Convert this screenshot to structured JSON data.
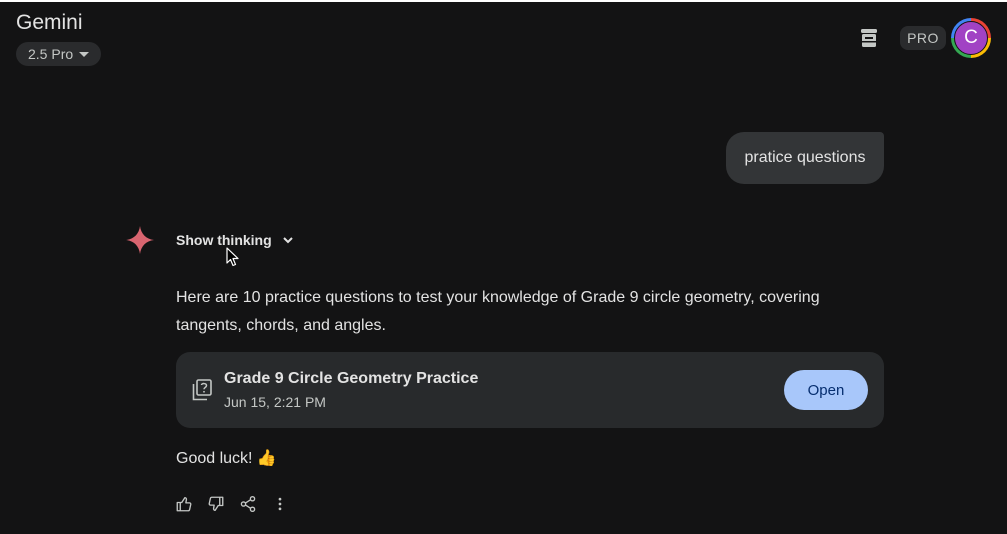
{
  "app": {
    "title": "Gemini"
  },
  "model": {
    "label": "2.5 Pro"
  },
  "header": {
    "pro_badge": "PRO",
    "avatar_initial": "C"
  },
  "chat": {
    "user_message": "pratice questions",
    "thinking_toggle": "Show thinking",
    "response_text": "Here are 10 practice questions to test your knowledge of Grade 9 circle geometry, covering tangents, chords, and angles.",
    "document": {
      "title": "Grade 9 Circle Geometry Practice",
      "date": "Jun 15, 2:21 PM",
      "open_label": "Open"
    },
    "closing_text": "Good luck! 👍"
  },
  "icons": {
    "header_action": "archive-icon",
    "thinking_expand": "chevron-down-icon",
    "assistant": "gemini-spark-icon",
    "document": "quiz-doc-icon",
    "actions": [
      "thumbs-up-icon",
      "thumbs-down-icon",
      "share-icon",
      "more-vertical-icon"
    ]
  },
  "colors": {
    "background": "#131314",
    "bubble": "#333537",
    "card": "#282a2c",
    "accent_button": "#a8c7fa",
    "spark": "#d96570",
    "avatar": "#a142c4"
  }
}
